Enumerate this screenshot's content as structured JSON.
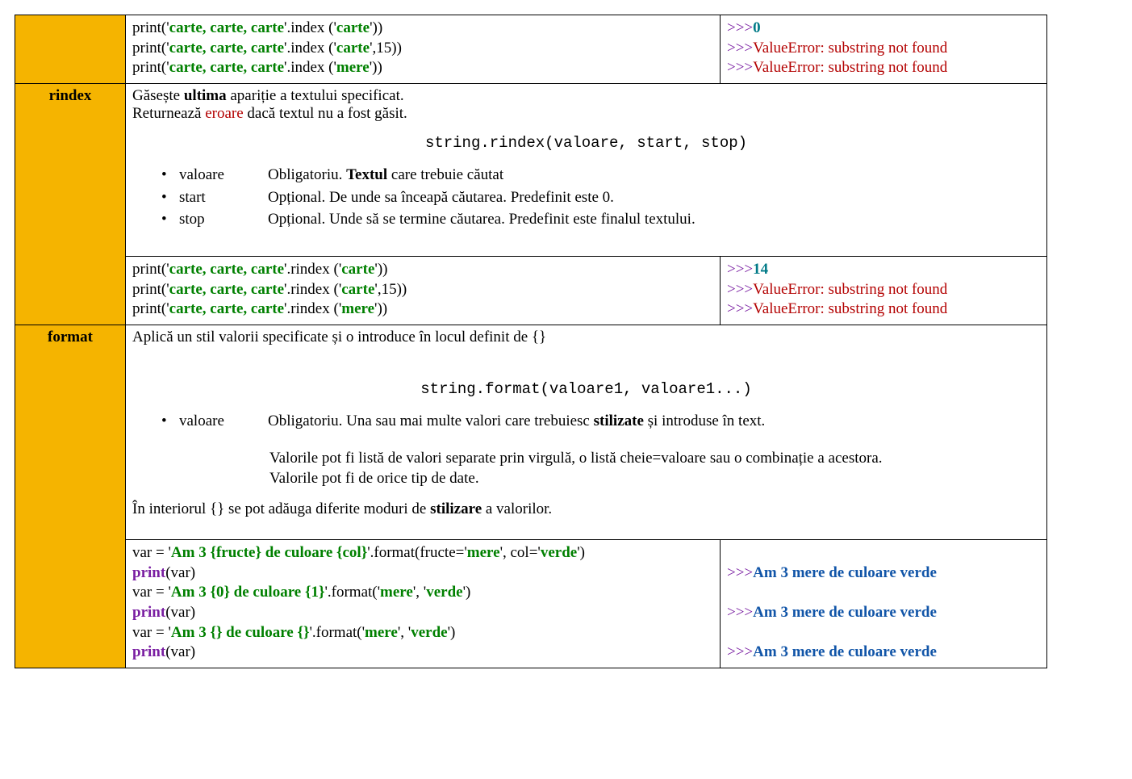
{
  "row1": {
    "code": {
      "l1": {
        "p": "print('",
        "s": "carte, carte, carte",
        "m": "'.index ('",
        "a": "carte",
        "t": "'))"
      },
      "l2": {
        "p": "print('",
        "s": "carte, carte, carte",
        "m": "'.index ('",
        "a": "carte",
        "c": "',15))"
      },
      "l3": {
        "p": "print('",
        "s": "carte, carte, carte",
        "m": "'.index ('",
        "a": "mere",
        "t": "'))"
      }
    },
    "out": {
      "p": ">>>",
      "v": "0",
      "e": "ValueError: substring not found"
    }
  },
  "rindex": {
    "name": "rindex",
    "desc": {
      "a": "Găsește ",
      "b": "ultima",
      "c": " apariție a textului specificat.",
      "d": "Returnează ",
      "e": "eroare",
      "f": " dacă textul nu a fost găsit."
    },
    "sig": "string.rindex(valoare, start, stop)",
    "params": [
      {
        "n": "valoare",
        "a": "Obligatoriu. ",
        "b": "Textul",
        "c": " care trebuie căutat"
      },
      {
        "n": "start",
        "a": "Opțional. De unde sa înceapă căutarea. Predefinit este 0.",
        "b": "",
        "c": ""
      },
      {
        "n": "stop",
        "a": "Opțional. Unde să se termine căutarea. Predefinit este finalul textului.",
        "b": "",
        "c": ""
      }
    ],
    "code": {
      "l1": {
        "p": "print('",
        "s": "carte, carte, carte",
        "m": "'.rindex ('",
        "a": "carte",
        "t": "'))"
      },
      "l2": {
        "p": "print('",
        "s": "carte, carte, carte",
        "m": "'.rindex ('",
        "a": "carte",
        "c": "',15))"
      },
      "l3": {
        "p": "print('",
        "s": "carte, carte, carte",
        "m": "'.rindex ('",
        "a": "mere",
        "t": "'))"
      }
    },
    "out": {
      "p": ">>>",
      "v": "14",
      "e": "ValueError: substring not found"
    }
  },
  "format": {
    "name": "format",
    "desc": {
      "a": "Aplică un stil valorii specificate și o introduce în locul definit de {}"
    },
    "sig": "string.format(valoare1, valoare1...)",
    "param": {
      "n": "valoare",
      "a": "Obligatoriu. Una sau mai multe valori care trebuiesc ",
      "b": "stilizate",
      "c": " și introduse în text."
    },
    "extra": {
      "l1": "Valorile pot fi listă de valori separate prin virgulă, o listă cheie=valoare sau o combinație a acestora.",
      "l2": "Valorile pot fi de orice tip de date."
    },
    "note": {
      "a": "În interiorul {} se pot adăuga diferite moduri de ",
      "b": "stilizare",
      "c": " a valorilor."
    },
    "code": {
      "l1": {
        "a": "var = '",
        "s": "Am 3 {fructe} de culoare {col}",
        "m": "'.format(fructe='",
        "v1": "mere",
        "x": "', col='",
        "v2": "verde",
        "t": "')"
      },
      "pr": "print",
      "po": "(var)",
      "l2": {
        "a": "var = '",
        "s": "Am 3 {0} de culoare {1}",
        "m": "'.format('",
        "v1": "mere",
        "x": "', '",
        "v2": "verde",
        "t": "')"
      },
      "l3": {
        "a": "var = '",
        "s": "Am 3 {} de culoare {}",
        "m": "'.format('",
        "v1": "mere",
        "x": "', '",
        "v2": "verde",
        "t": "')"
      }
    },
    "out": {
      "p": ">>>",
      "v": "Am 3 mere de culoare verde"
    }
  }
}
